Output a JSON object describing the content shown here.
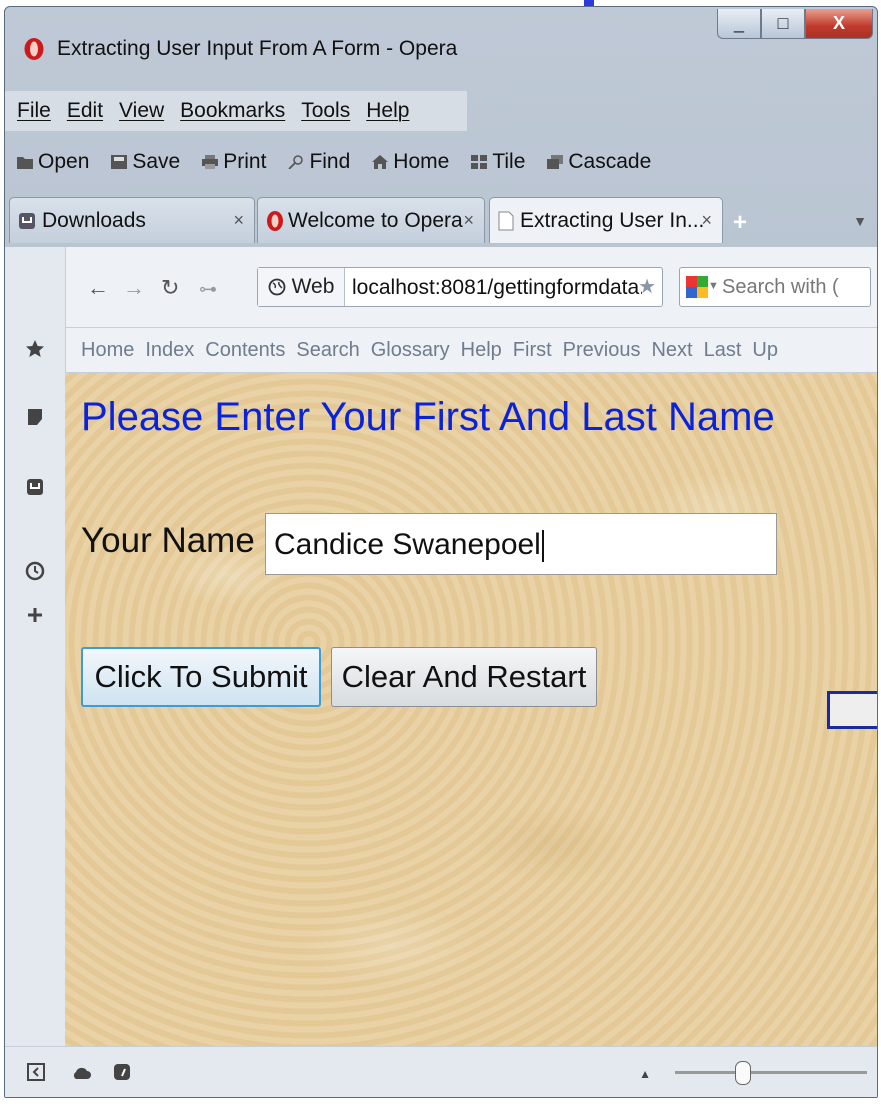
{
  "window": {
    "title": "Extracting User Input From A Form - Opera",
    "controls": {
      "minimize": "_",
      "maximize": "□",
      "close": "X"
    }
  },
  "menu": [
    "File",
    "Edit",
    "View",
    "Bookmarks",
    "Tools",
    "Help"
  ],
  "toolbar": {
    "open": "Open",
    "save": "Save",
    "print": "Print",
    "find": "Find",
    "home": "Home",
    "tile": "Tile",
    "cascade": "Cascade"
  },
  "tabs": [
    {
      "label": "Downloads",
      "close": "×"
    },
    {
      "label": "Welcome to Opera",
      "close": "×"
    },
    {
      "label": "Extracting User In...",
      "close": "×",
      "active": true
    }
  ],
  "address": {
    "badge": "Web",
    "url": "localhost:8081/gettingformdata.",
    "search_placeholder": "Search with ("
  },
  "linkbar": [
    "Home",
    "Index",
    "Contents",
    "Search",
    "Glossary",
    "Help",
    "First",
    "Previous",
    "Next",
    "Last",
    "Up"
  ],
  "page": {
    "heading": "Please Enter Your First And Last Name",
    "name_label": "Your Name",
    "name_value": "Candice Swanepoel",
    "submit_label": "Click To Submit",
    "clear_label": "Clear And Restart"
  },
  "colors": {
    "heading": "#0a22d8",
    "opera_red": "#cc1a1a",
    "close_button": "#c0392b"
  },
  "icons": {
    "sidebar": [
      "bookmark-star-icon",
      "notes-icon",
      "downloads-icon",
      "history-icon",
      "add-panel-icon"
    ],
    "status": [
      "panel-toggle-icon",
      "turbo-icon",
      "speed-dial-icon"
    ]
  }
}
